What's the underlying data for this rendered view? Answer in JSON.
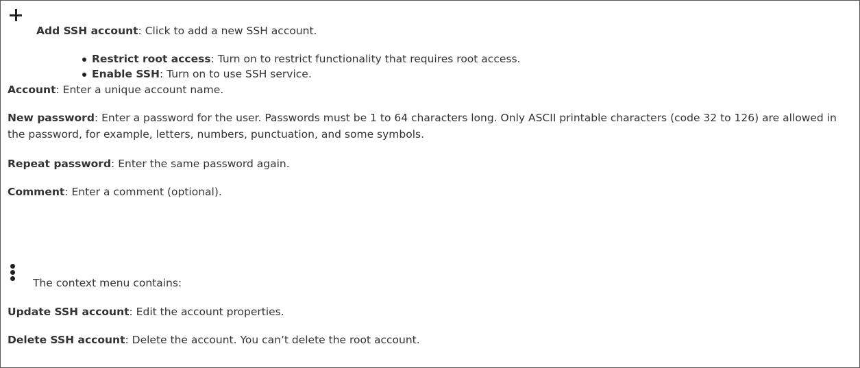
{
  "add_item": {
    "title": "Add SSH account",
    "desc": ": Click to add a new SSH account.",
    "bullets": [
      {
        "title": "Restrict root access",
        "desc": ": Turn on to restrict functionality that requires root access."
      },
      {
        "title": "Enable SSH",
        "desc": ": Turn on to use SSH service."
      }
    ]
  },
  "fields": [
    {
      "title": "Account",
      "desc": ": Enter a unique account name."
    },
    {
      "title": "New password",
      "desc": ": Enter a password for the user. Passwords must be 1 to 64 characters long. Only ASCII printable characters (code 32 to 126) are allowed in the password, for example, letters, numbers, punctuation, and some symbols."
    },
    {
      "title": "Repeat password",
      "desc": ": Enter the same password again."
    },
    {
      "title": "Comment",
      "desc": ": Enter a comment (optional)."
    }
  ],
  "context_menu": {
    "intro": "The context menu contains:",
    "items": [
      {
        "title": "Update SSH account",
        "desc": ": Edit the account properties."
      },
      {
        "title": "Delete SSH account",
        "desc": ": Delete the account. You can’t delete the root account."
      }
    ]
  }
}
